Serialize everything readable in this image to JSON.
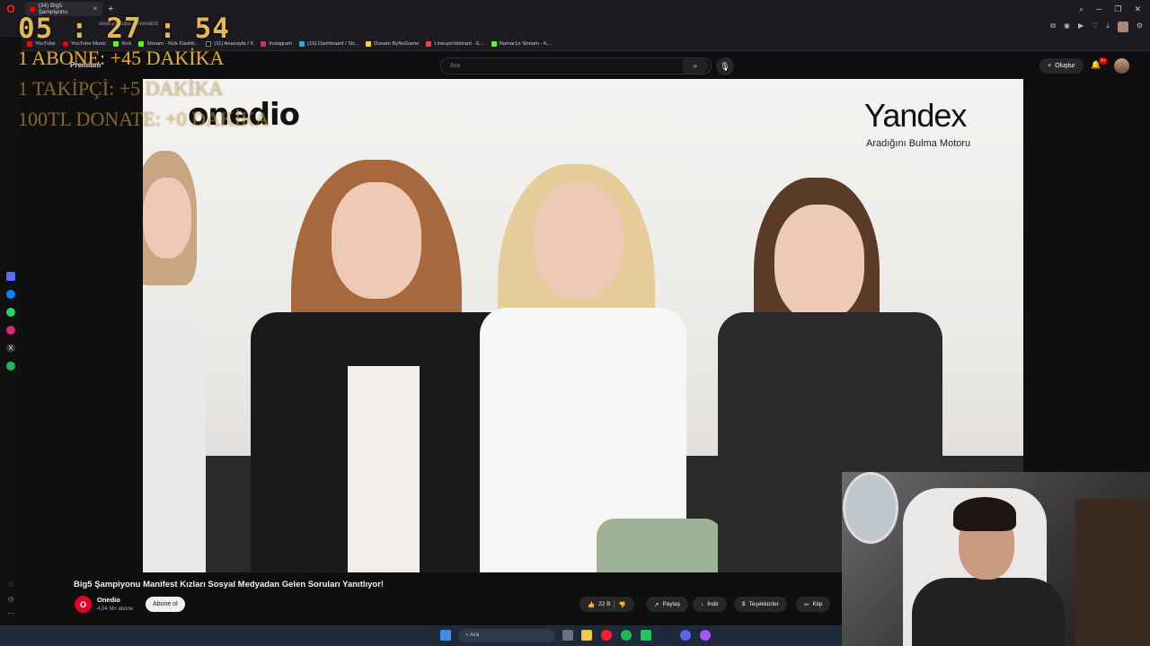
{
  "browser": {
    "tab_title": "(34) Big5 Şampiyonu",
    "url": "www.youtube.com/watch",
    "bookmarks": [
      "YouTube",
      "YouTube Music",
      "Kick",
      "Stream - Kick Dashb...",
      "(11) Anasayfa / X",
      "Instagram",
      "(16) Dashboard / Str...",
      "Donate ByNoGame",
      "LineupsValorant - E...",
      "Namar1e Stream - K..."
    ]
  },
  "youtube": {
    "logo_text": "Premium",
    "search_placeholder": "Ara",
    "create_label": "Oluştur",
    "notification_count": "9+",
    "video_title": "Big5 Şampiyonu Manifest Kızları Sosyal Medyadan Gelen Soruları Yanıtlıyor!",
    "channel_name": "Onedio",
    "channel_subs": "4,04 Mn abone",
    "subscribe_label": "Abone ol",
    "like_count": "22 B",
    "share_label": "Paylaş",
    "download_label": "İndir",
    "thanks_label": "Teşekkürler",
    "clip_label": "Klip"
  },
  "video_frame": {
    "onedio_brand": "onedio",
    "sponsor_brand": "Yandex",
    "sponsor_tagline": "Aradığını Bulma Motoru"
  },
  "overlay": {
    "timer": "05 : 27 : 54",
    "line1": "1 ABONE: +45 DAKİKA",
    "line2": "1 TAKİPÇİ: +5 DAKİKA",
    "line3": "100TL DONATE: +0 DAKİKA"
  },
  "taskbar": {
    "search_label": "Ara"
  },
  "colors": {
    "accent_red": "#ff0000",
    "overlay_gold": "#e2b65a",
    "yt_bg": "#0f0f0f"
  }
}
